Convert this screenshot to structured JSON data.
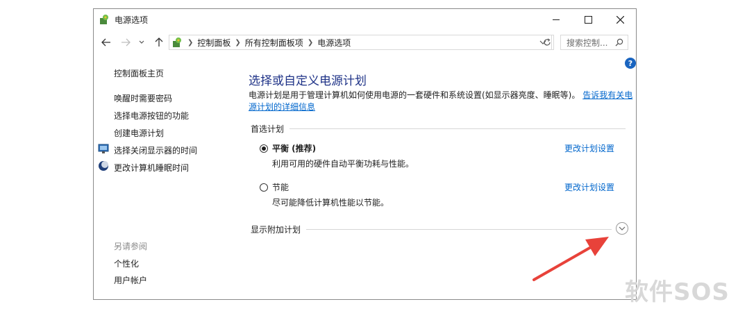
{
  "window": {
    "title": "电源选项",
    "controls": {
      "minimize": "minimize",
      "maximize": "maximize",
      "close": "close"
    }
  },
  "navigation": {
    "breadcrumb": [
      "控制面板",
      "所有控制面板项",
      "电源选项"
    ],
    "search_placeholder": "搜索控制..."
  },
  "sidebar": {
    "home": "控制面板主页",
    "links": [
      "唤醒时需要密码",
      "选择电源按钮的功能",
      "创建电源计划",
      "选择关闭显示器的时间",
      "更改计算机睡眠时间"
    ],
    "see_also_title": "另请参阅",
    "see_also": [
      "个性化",
      "用户帐户"
    ]
  },
  "main": {
    "title": "选择或自定义电源计划",
    "description": "电源计划是用于管理计算机如何使用电源的一套硬件和系统设置(如显示器亮度、睡眠等)。",
    "description_link": "告诉我有关电源计划的详细信息",
    "preferred_section": "首选计划",
    "plans": [
      {
        "name": "平衡 (推荐)",
        "description": "利用可用的硬件自动平衡功耗与性能。",
        "link": "更改计划设置",
        "selected": true
      },
      {
        "name": "节能",
        "description": "尽可能降低计算机性能以节能。",
        "link": "更改计划设置",
        "selected": false
      }
    ],
    "additional_section": "显示附加计划"
  },
  "annotation": {
    "arrow_color": "#e8423a"
  },
  "watermark": "软件SOS",
  "colors": {
    "link": "#0066cc",
    "title": "#1e3287",
    "help": "#1a65c0"
  }
}
